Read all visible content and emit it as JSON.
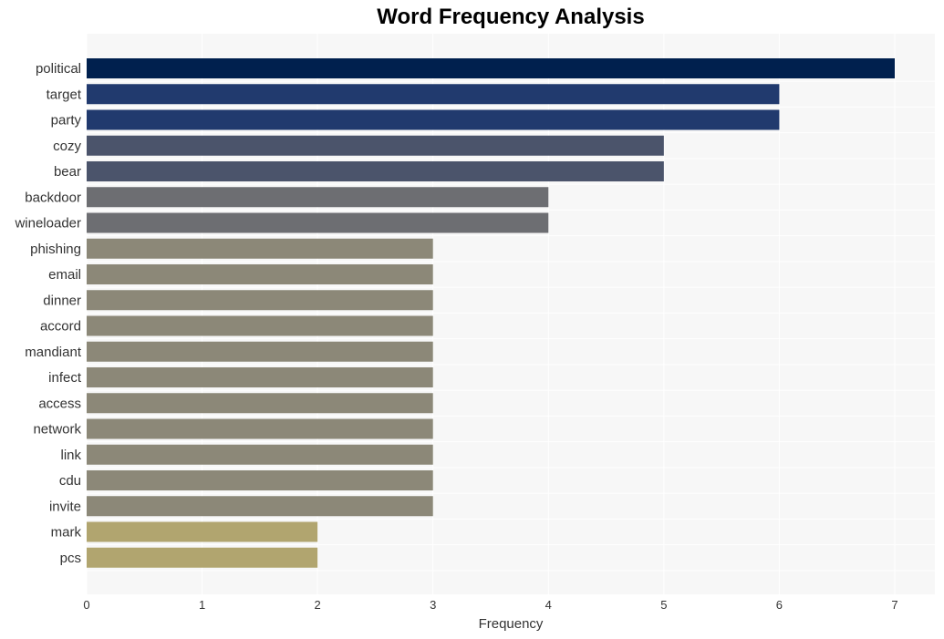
{
  "chart_data": {
    "type": "bar",
    "orientation": "horizontal",
    "title": "Word Frequency Analysis",
    "xlabel": "Frequency",
    "ylabel": "",
    "xlim": [
      0,
      7.35
    ],
    "xticks": [
      0,
      1,
      2,
      3,
      4,
      5,
      6,
      7
    ],
    "grid": true,
    "categories": [
      "political",
      "target",
      "party",
      "cozy",
      "bear",
      "backdoor",
      "wineloader",
      "phishing",
      "email",
      "dinner",
      "accord",
      "mandiant",
      "infect",
      "access",
      "network",
      "link",
      "cdu",
      "invite",
      "mark",
      "pcs"
    ],
    "values": [
      7,
      6,
      6,
      5,
      5,
      4,
      4,
      3,
      3,
      3,
      3,
      3,
      3,
      3,
      3,
      3,
      3,
      3,
      2,
      2
    ],
    "colors_by_value": {
      "7": "#00204e",
      "6": "#213a6e",
      "5": "#4b546b",
      "4": "#6d6e72",
      "3": "#8c8878",
      "2": "#b1a56f"
    },
    "plot_background": "#f7f7f7",
    "grid_color": "#ffffff"
  }
}
